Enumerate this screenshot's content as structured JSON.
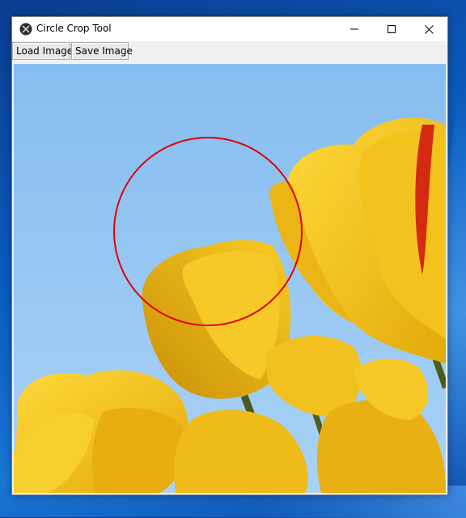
{
  "window": {
    "title": "Circle Crop Tool",
    "icon": "app-logo-icon"
  },
  "titlebar_controls": {
    "minimize_icon": "minimize-icon",
    "maximize_icon": "maximize-icon",
    "close_icon": "close-icon"
  },
  "toolbar": {
    "load_label": "Load Image",
    "save_label": "Save Image"
  },
  "canvas": {
    "image": "yellow tulips against blue sky",
    "crop_circle_color": "#e00000"
  },
  "colors": {
    "sky": "#8ec4f2",
    "tulip": "#f2c21a",
    "crop_circle": "#e00000"
  }
}
